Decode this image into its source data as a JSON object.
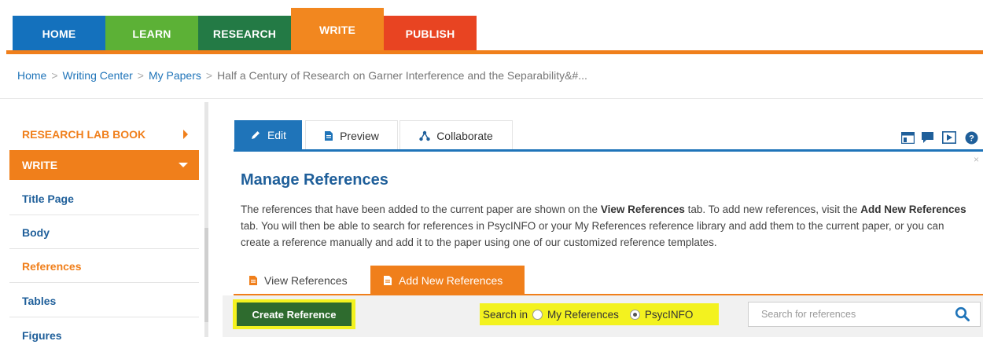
{
  "top_nav": {
    "items": [
      {
        "label": "HOME",
        "color": "#1471bd"
      },
      {
        "label": "LEARN",
        "color": "#5cb136"
      },
      {
        "label": "RESEARCH",
        "color": "#237a45"
      },
      {
        "label": "WRITE",
        "color": "#f2871f"
      },
      {
        "label": "PUBLISH",
        "color": "#e84422"
      }
    ],
    "active": "WRITE",
    "underline_color": "#f07f1b"
  },
  "breadcrumb": {
    "items": [
      "Home",
      "Writing Center",
      "My Papers"
    ],
    "current": "Half a Century of Research on Garner Interference and the Separability&#...",
    "separator": ">"
  },
  "sidebar": {
    "section_research": "RESEARCH LAB BOOK",
    "section_write": "WRITE",
    "items": [
      "Title Page",
      "Body",
      "References",
      "Tables",
      "Figures"
    ],
    "active_item": "References"
  },
  "content_tabs": {
    "edit": "Edit",
    "preview": "Preview",
    "collaborate": "Collaborate",
    "active": "Edit"
  },
  "panel": {
    "title": "Manage References",
    "desc_1": "The references that have been added to the current paper are shown on the ",
    "desc_view_tab": "View References",
    "desc_2": " tab. To add new references, visit the ",
    "desc_add_tab": "Add New References",
    "desc_3": " tab. You will then be able to search for references in PsycINFO or your My References reference library and add them to the current paper, or you can create a reference manually and add it to the paper using one of our customized reference templates.",
    "close_label": "×"
  },
  "ref_tabs": {
    "view": "View References",
    "add": "Add New References",
    "active": "Add New References"
  },
  "toolbar": {
    "create_button": "Create Reference",
    "search_in_label": "Search in",
    "option_my_refs": "My References",
    "option_psycinfo": "PsycINFO",
    "selected_source": "PsycINFO",
    "search_placeholder": "Search for references"
  },
  "colors": {
    "blue": "#1f74b9",
    "orange": "#f07f1b",
    "highlight": "#f3f21f",
    "create_green": "#2e6b2e"
  }
}
